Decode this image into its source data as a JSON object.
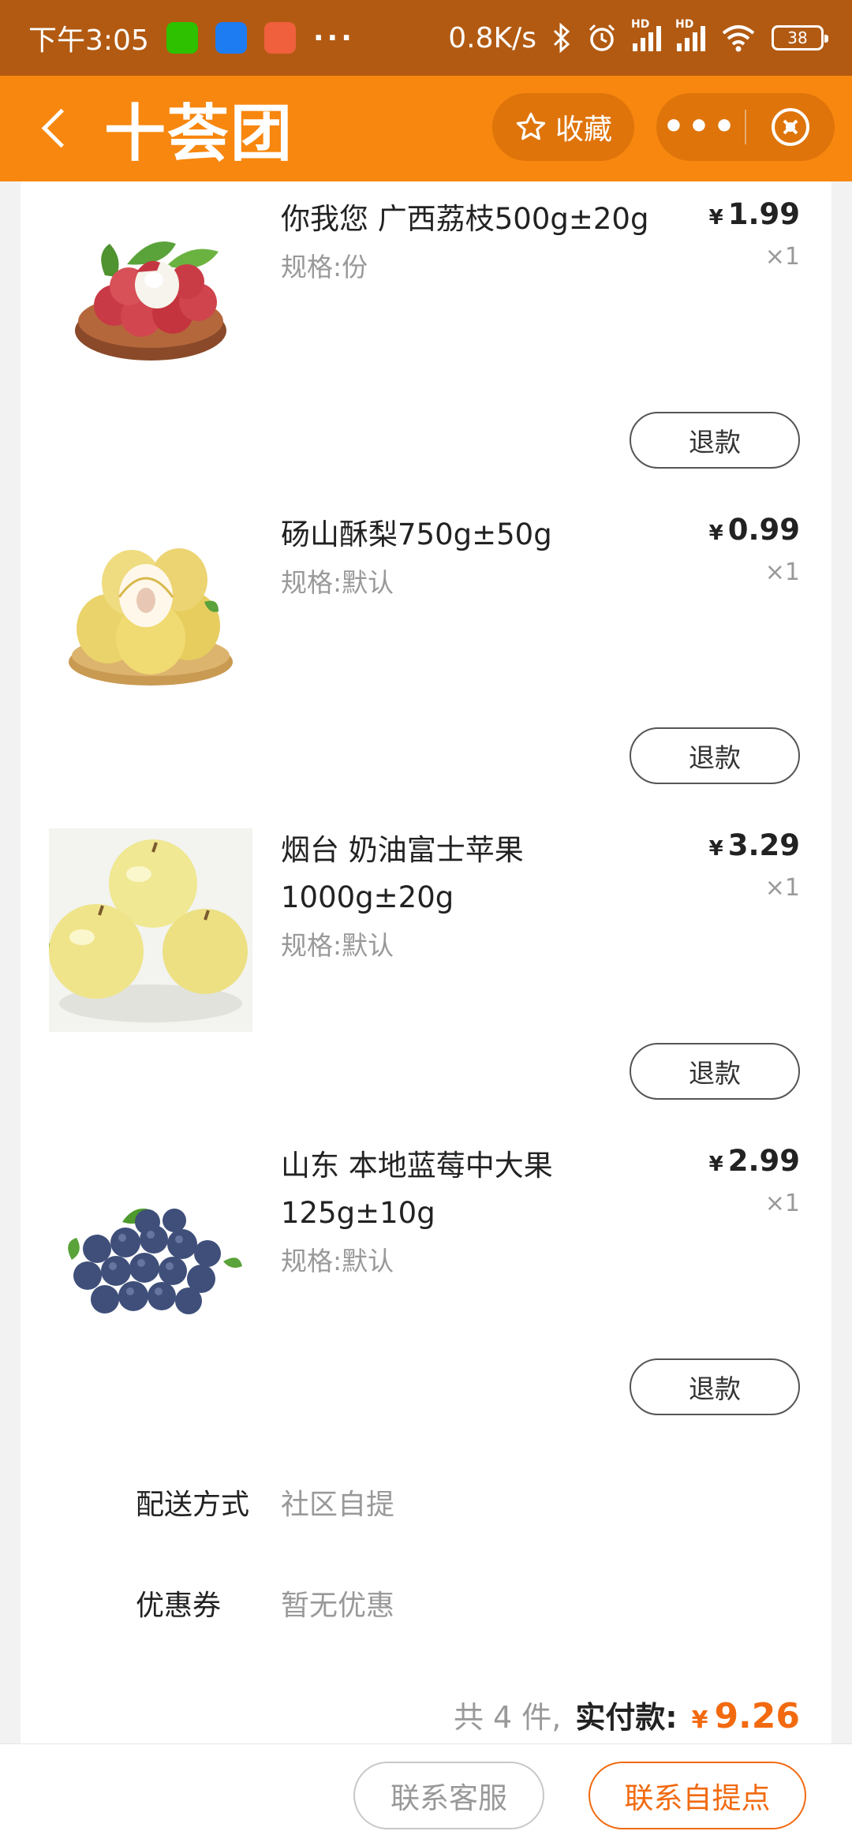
{
  "status_bar": {
    "time": "下午3:05",
    "more": "···",
    "speed": "0.8K/s",
    "signal_1": "HD",
    "signal_2": "HD",
    "battery": "38"
  },
  "header": {
    "logo": "十荟团",
    "favorite_label": "收藏",
    "accent_color": "#f7870f"
  },
  "items": [
    {
      "name": "你我您 广西荔枝500g±20g",
      "spec": "规格:份",
      "currency": "¥",
      "price": "1.99",
      "qty": "×1",
      "refund_label": "退款",
      "image": "lychee-photo"
    },
    {
      "name": "砀山酥梨750g±50g",
      "spec": "规格:默认",
      "currency": "¥",
      "price": "0.99",
      "qty": "×1",
      "refund_label": "退款",
      "image": "pear-photo"
    },
    {
      "name": "烟台 奶油富士苹果1000g±20g",
      "spec": "规格:默认",
      "currency": "¥",
      "price": "3.29",
      "qty": "×1",
      "refund_label": "退款",
      "image": "apple-photo"
    },
    {
      "name": "山东 本地蓝莓中大果125g±10g",
      "spec": "规格:默认",
      "currency": "¥",
      "price": "2.99",
      "qty": "×1",
      "refund_label": "退款",
      "image": "blueberry-photo"
    }
  ],
  "delivery": {
    "label": "配送方式",
    "value": "社区自提"
  },
  "coupon": {
    "label": "优惠券",
    "value": "暂无优惠"
  },
  "summary": {
    "count": "共 4 件,",
    "paid_label": "实付款:",
    "currency": "¥",
    "amount": "9.26",
    "price_color": "#f26a10"
  },
  "bottom": {
    "service_label": "联系客服",
    "pickup_label": "联系自提点"
  }
}
